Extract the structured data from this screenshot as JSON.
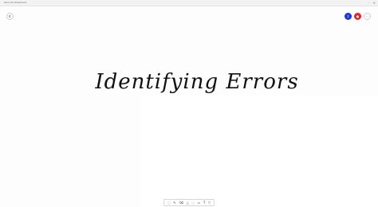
{
  "window": {
    "title": "Microsoft Whiteboard",
    "controls": [
      {
        "name": "minimize-button",
        "glyph": "–"
      },
      {
        "name": "close-button",
        "glyph": "✕"
      }
    ]
  },
  "header": {
    "buttons": [
      {
        "name": "share-button",
        "icon": "share-icon",
        "glyph": "↥",
        "color": "#1a36e6"
      },
      {
        "name": "user-avatar-button",
        "icon": "user-icon",
        "glyph": "●",
        "color": "#e3242b"
      },
      {
        "name": "more-options-button",
        "icon": "more-icon",
        "glyph": "⋯"
      }
    ]
  },
  "canvas": {
    "title": "Identifying Errors"
  },
  "toolbar": {
    "tools": [
      {
        "name": "select-tool",
        "icon": "select-icon",
        "glyph": "⬚"
      },
      {
        "name": "pen-tool",
        "icon": "pen-icon",
        "glyph": "✎"
      },
      {
        "name": "eraser-tool",
        "icon": "eraser-icon",
        "glyph": "⌫"
      },
      {
        "name": "ruler-tool",
        "icon": "ruler-icon",
        "glyph": "△"
      },
      {
        "name": "lasso-tool",
        "icon": "lasso-icon",
        "glyph": "◌"
      },
      {
        "name": "shapes-tool",
        "icon": "shapes-icon",
        "glyph": "▭"
      },
      {
        "name": "text-tool",
        "icon": "text-icon",
        "glyph": "T"
      },
      {
        "name": "note-tool",
        "icon": "note-icon",
        "glyph": "▽"
      }
    ]
  }
}
